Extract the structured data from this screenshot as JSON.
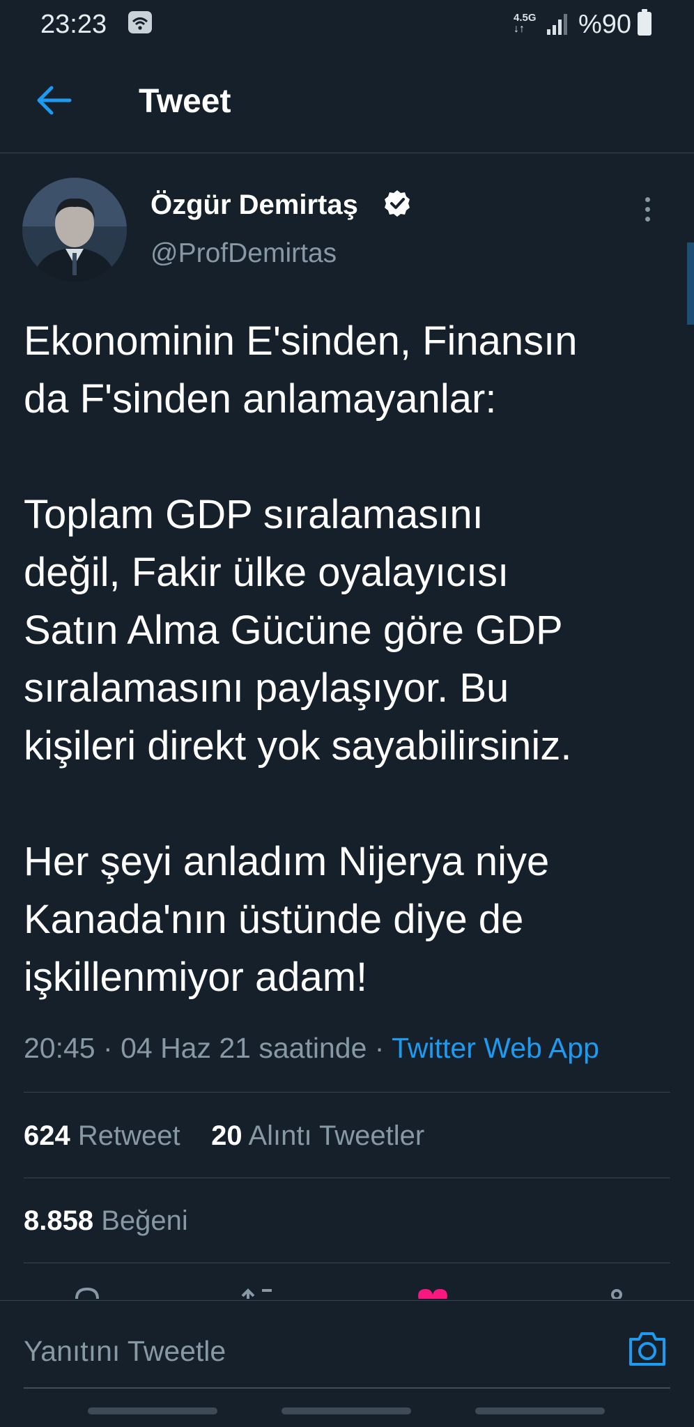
{
  "status_bar": {
    "time": "23:23",
    "network": "4.5G",
    "battery": "%90",
    "icons": [
      "wifi-icon",
      "signal-icon",
      "battery-icon"
    ]
  },
  "header": {
    "title": "Tweet",
    "back_icon": "arrow-left-icon"
  },
  "author": {
    "name": "Özgür Demirtaş",
    "handle": "@ProfDemirtas",
    "verified": true
  },
  "tweet": {
    "paragraphs": [
      [
        "Ekonominin E'sinden, Finansın",
        "da F'sinden anlamayanlar:"
      ],
      [
        "Toplam GDP sıralamasını",
        "değil, Fakir ülke oyalayıcısı",
        "Satın Alma Gücüne göre GDP",
        "sıralamasını paylaşıyor. Bu",
        "kişileri direkt yok sayabilirsiniz."
      ],
      [
        "Her şeyi anladım Nijerya niye",
        "Kanada'nın üstünde diye de",
        "işkillenmiyor adam!"
      ]
    ],
    "meta": {
      "time": "20:45",
      "date_text": "04 Haz 21 saatinde",
      "separator": "·",
      "source": "Twitter Web App"
    }
  },
  "stats": {
    "retweets": {
      "count": "624",
      "label": "Retweet"
    },
    "quotes": {
      "count": "20",
      "label": "Alıntı Tweetler"
    },
    "likes": {
      "count": "8.858",
      "label": "Beğeni"
    }
  },
  "actions": [
    "reply-icon",
    "retweet-icon",
    "like-icon",
    "share-icon"
  ],
  "reply": {
    "placeholder": "Yanıtını Tweetle",
    "camera_icon": "camera-icon"
  },
  "colors": {
    "background": "#15202b",
    "accent": "#1d9bf0",
    "muted": "#8899a6",
    "like": "#f91880"
  }
}
